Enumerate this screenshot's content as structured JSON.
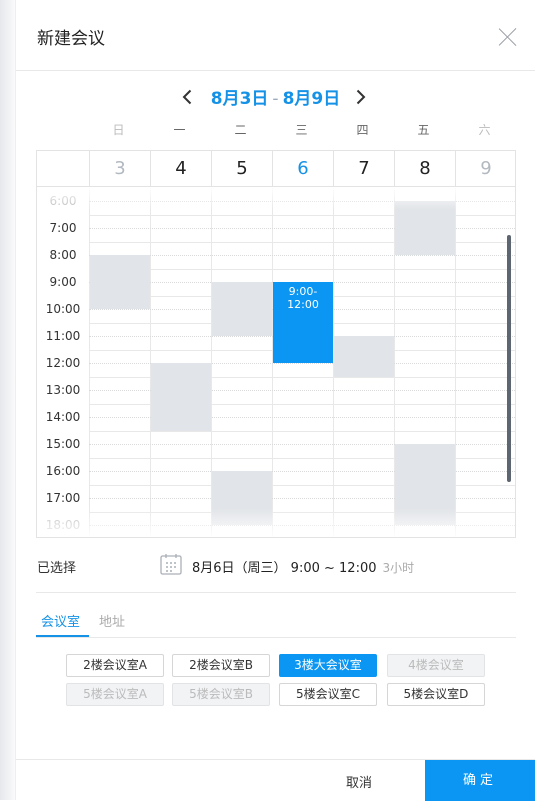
{
  "dialog": {
    "title": "新建会议"
  },
  "week": {
    "range_start": "8月3日",
    "range_sep": "-",
    "range_end": "8月9日"
  },
  "weekdays": [
    {
      "label": "日",
      "date": "3",
      "state": "weekend"
    },
    {
      "label": "一",
      "date": "4",
      "state": "normal"
    },
    {
      "label": "二",
      "date": "5",
      "state": "normal"
    },
    {
      "label": "三",
      "date": "6",
      "state": "today"
    },
    {
      "label": "四",
      "date": "7",
      "state": "normal"
    },
    {
      "label": "五",
      "date": "8",
      "state": "normal"
    },
    {
      "label": "六",
      "date": "9",
      "state": "weekend"
    }
  ],
  "times": [
    "6:00",
    "7:00",
    "8:00",
    "9:00",
    "10:00",
    "11:00",
    "12:00",
    "13:00",
    "14:00",
    "15:00",
    "16:00",
    "17:00",
    "18:00"
  ],
  "busy_slots": [
    {
      "day": 0,
      "start": 8.0,
      "end": 10.0
    },
    {
      "day": 1,
      "start": 12.0,
      "end": 14.5
    },
    {
      "day": 2,
      "start": 9.0,
      "end": 11.0
    },
    {
      "day": 2,
      "start": 16.0,
      "end": 18.0
    },
    {
      "day": 4,
      "start": 11.0,
      "end": 12.5
    },
    {
      "day": 5,
      "start": 6.0,
      "end": 8.0
    },
    {
      "day": 5,
      "start": 15.0,
      "end": 18.0
    }
  ],
  "selected_slot": {
    "day": 3,
    "start": 9.0,
    "end": 12.0,
    "label": "9:00-12:00"
  },
  "chosen": {
    "label": "已选择",
    "text": "8月6日（周三） 9:00 ~ 12:00",
    "duration": "3小时"
  },
  "tabs": [
    {
      "label": "会议室",
      "active": true
    },
    {
      "label": "地址",
      "active": false
    }
  ],
  "rooms": [
    {
      "label": "2楼会议室A",
      "state": "normal"
    },
    {
      "label": "2楼会议室B",
      "state": "normal"
    },
    {
      "label": "3楼大会议室",
      "state": "selected"
    },
    {
      "label": "4楼会议室",
      "state": "disabled"
    },
    {
      "label": "5楼会议室A",
      "state": "disabled"
    },
    {
      "label": "5楼会议室B",
      "state": "disabled"
    },
    {
      "label": "5楼会议室C",
      "state": "normal"
    },
    {
      "label": "5楼会议室D",
      "state": "normal"
    }
  ],
  "footer": {
    "cancel_label": "取消",
    "ok_label": "确定"
  },
  "colors": {
    "accent": "#0a96f2",
    "busy": "#e1e4e8",
    "disabled": "#bbbbbb"
  }
}
